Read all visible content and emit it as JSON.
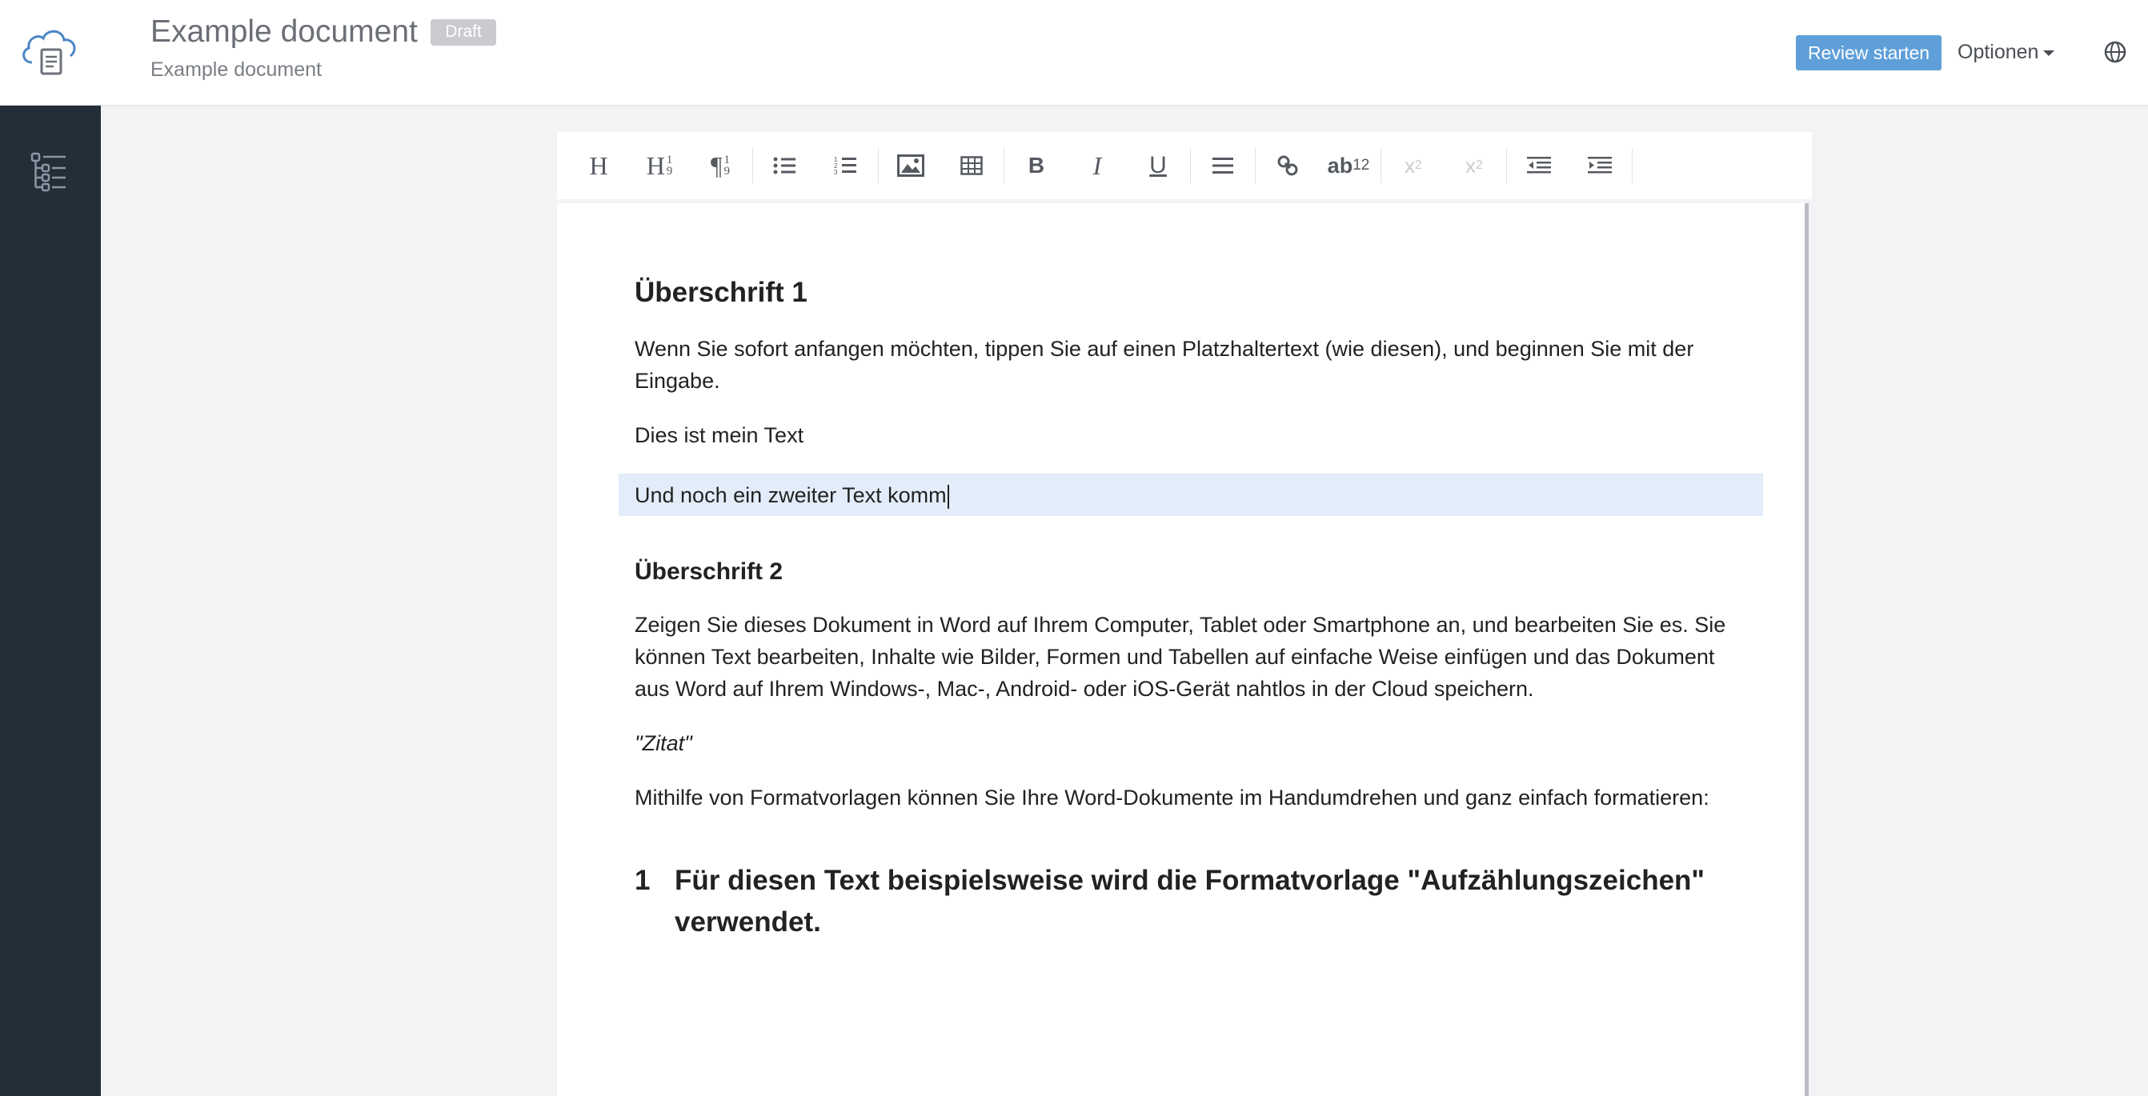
{
  "header": {
    "title": "Example document",
    "badge": "Draft",
    "subtitle": "Example document",
    "review_button": "Review starten",
    "options_menu": "Optionen",
    "logo_icon": "cloud-document-icon",
    "globe_icon": "globe-icon"
  },
  "sidebar": {
    "outline_icon": "outline-tree-icon"
  },
  "toolbar": {
    "heading": "H",
    "heading_numbered": "H",
    "heading_numbered_sup": "1",
    "heading_numbered_sub": "9",
    "paragraph_numbered": "¶",
    "paragraph_numbered_sup": "1",
    "paragraph_numbered_sub": "9",
    "bold": "B",
    "italic": "I",
    "underline": "U",
    "footnote": "ab",
    "footnote_sup": "12",
    "superscript": "x",
    "superscript_sup": "2",
    "subscript": "x",
    "subscript_sub": "2",
    "icons": [
      "heading-icon",
      "numbered-heading-icon",
      "numbered-paragraph-icon",
      "bullet-list-icon",
      "numbered-list-icon",
      "image-icon",
      "table-icon",
      "bold-icon",
      "italic-icon",
      "underline-icon",
      "align-icon",
      "link-icon",
      "footnote-icon",
      "superscript-icon",
      "subscript-icon",
      "outdent-icon",
      "indent-icon"
    ]
  },
  "document": {
    "heading1": "Überschrift 1",
    "p1": "Wenn Sie sofort anfangen möchten, tippen Sie auf einen Platzhaltertext (wie diesen), und beginnen Sie mit der Eingabe.",
    "p2": "Dies ist mein Text",
    "p3_editing": "Und noch ein zweiter Text komm",
    "heading2": "Überschrift 2",
    "p4": "Zeigen Sie dieses Dokument in Word auf Ihrem Computer, Tablet oder Smartphone an, und bearbeiten Sie es. Sie können Text bearbeiten, Inhalte wie Bilder, Formen und Tabellen auf einfache Weise einfügen und das Dokument aus Word auf Ihrem Windows-, Mac-, Android- oder iOS-Gerät nahtlos in der Cloud speichern.",
    "quote": "\"Zitat\"",
    "p5": "Mithilfe von Formatvorlagen können Sie Ihre Word-Dokumente im Handumdrehen und ganz einfach formatieren:",
    "list_number": "1",
    "list_item": "Für diesen Text beispielsweise wird die Formatvorlage \"Aufzählungszeichen\" verwendet."
  },
  "colors": {
    "sidebar": "#232e39",
    "accent": "#5f9fd9",
    "highlight": "#e3edf9",
    "badge": "#c9cbcf"
  }
}
